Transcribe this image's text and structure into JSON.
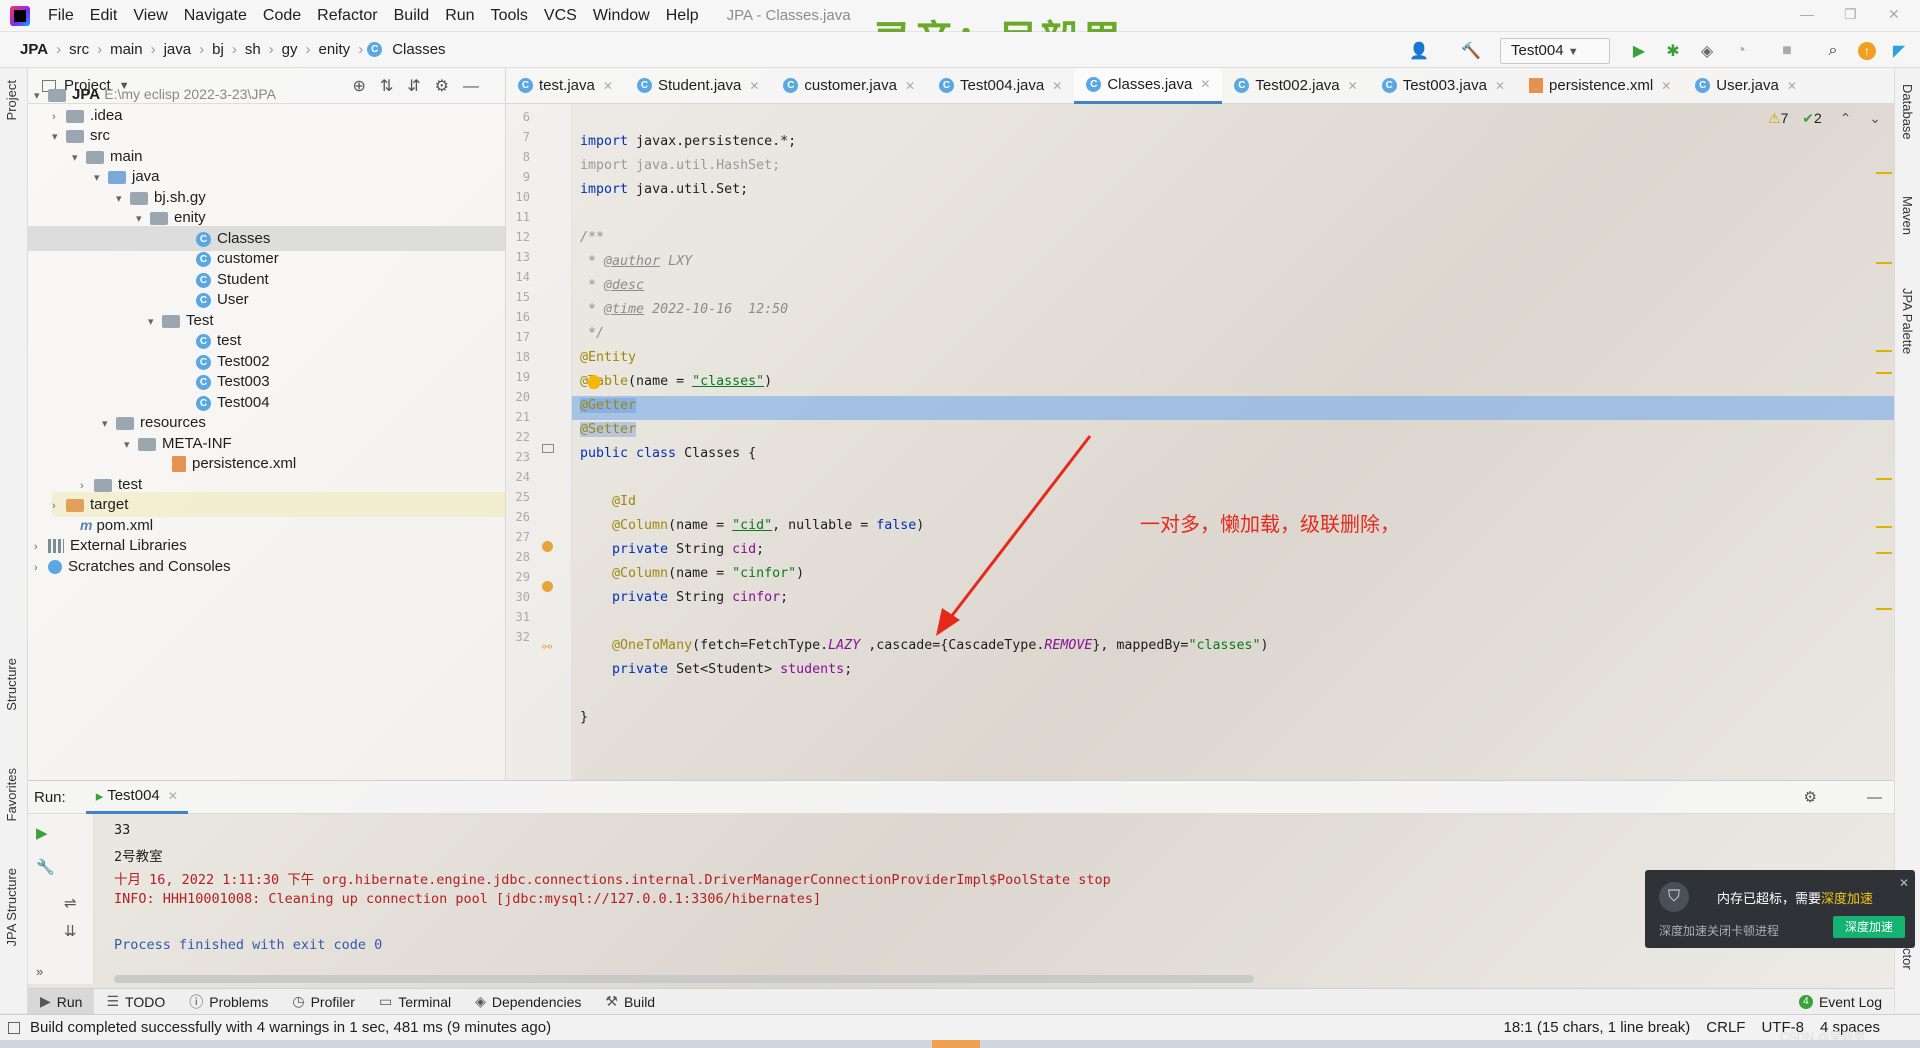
{
  "menubar": {
    "items": [
      "File",
      "Edit",
      "View",
      "Navigate",
      "Code",
      "Refactor",
      "Build",
      "Run",
      "Tools",
      "VCS",
      "Window",
      "Help"
    ],
    "window_title": "JPA - Classes.java",
    "overlay_text": "录音：吴毅男"
  },
  "navbar": {
    "crumbs": [
      "JPA",
      "src",
      "main",
      "java",
      "bj",
      "sh",
      "gy",
      "enity",
      "Classes"
    ],
    "run_config": "Test004"
  },
  "left_stripe": {
    "project": "Project",
    "structure": "Structure",
    "favorites": "Favorites",
    "jpa_structure": "JPA Structure"
  },
  "right_stripe": {
    "database": "Database",
    "maven": "Maven",
    "jpa_palette": "JPA Palette",
    "detector": "ctor"
  },
  "project": {
    "title": "Project",
    "tree": [
      {
        "label": "JPA",
        "path": "E:\\my eclisp 2022-3-23\\JPA"
      },
      {
        "label": ".idea"
      },
      {
        "label": "src"
      },
      {
        "label": "main"
      },
      {
        "label": "java"
      },
      {
        "label": "bj.sh.gy"
      },
      {
        "label": "enity"
      },
      {
        "label": "Classes"
      },
      {
        "label": "customer"
      },
      {
        "label": "Student"
      },
      {
        "label": "User"
      },
      {
        "label": "Test"
      },
      {
        "label": "test"
      },
      {
        "label": "Test002"
      },
      {
        "label": "Test003"
      },
      {
        "label": "Test004"
      },
      {
        "label": "resources"
      },
      {
        "label": "META-INF"
      },
      {
        "label": "persistence.xml"
      },
      {
        "label": "test"
      },
      {
        "label": "target"
      },
      {
        "label": "pom.xml"
      },
      {
        "label": "External Libraries"
      },
      {
        "label": "Scratches and Consoles"
      }
    ]
  },
  "tabs": [
    "test.java",
    "Student.java",
    "customer.java",
    "Test004.java",
    "Classes.java",
    "Test002.java",
    "Test003.java",
    "persistence.xml",
    "User.java"
  ],
  "editor": {
    "inspections": {
      "warnings": "7",
      "weak": "2"
    },
    "line_numbers": [
      "6",
      "7",
      "8",
      "9",
      "10",
      "11",
      "12",
      "13",
      "14",
      "15",
      "16",
      "17",
      "18",
      "19",
      "20",
      "21",
      "22",
      "23",
      "24",
      "25",
      "26",
      "27",
      "28",
      "29",
      "30",
      "31",
      "32"
    ],
    "code": {
      "l7a": "import",
      "l7b": " javax.persistence.*;",
      "l8": "import java.util.HashSet;",
      "l9a": "import",
      "l9b": " java.util.Set;",
      "l11": "/**",
      "l12a": " * ",
      "l12b": "@author",
      "l12c": " LXY",
      "l13a": " * ",
      "l13b": "@desc",
      "l14a": " * ",
      "l14b": "@time",
      "l14c": " 2022-10-16  12:50",
      "l15": " */",
      "l16": "@Entity",
      "l17a": "@Table",
      "l17b": "(name = ",
      "l17c": "\"classes\"",
      "l17d": ")",
      "l18": "@Getter",
      "l19": "@Setter",
      "l20a": "public class",
      "l20b": " Classes {",
      "l22": "    @Id",
      "l23a": "    @Column",
      "l23b": "(name = ",
      "l23c": "\"cid\"",
      "l23d": ", nullable = ",
      "l23e": "false",
      "l23f": ")",
      "l24a": "    private",
      "l24b": " String ",
      "l24c": "cid",
      "l24d": ";",
      "l25a": "    @Column",
      "l25b": "(name = ",
      "l25c": "\"cinfor\"",
      "l25d": ")",
      "l26a": "    private",
      "l26b": " String ",
      "l26c": "cinfor",
      "l26d": ";",
      "l28a": "    @OneToMany",
      "l28b": "(fetch=FetchType.",
      "l28c": "LAZY",
      "l28d": " ,cascade={CascadeType.",
      "l28e": "REMOVE",
      "l28f": "}, mappedBy=",
      "l28g": "\"classes\"",
      "l28h": ")",
      "l29a": "    private",
      "l29b": " Set<Student> ",
      "l29c": "students",
      "l29d": ";",
      "l31": "}"
    },
    "annotation_note": "一对多，懒加载，级联删除，"
  },
  "run": {
    "label": "Run:",
    "tab": "Test004",
    "console": [
      "33",
      "2号教室",
      "十月 16, 2022 1:11:30 下午 org.hibernate.engine.jdbc.connections.internal.DriverManagerConnectionProviderImpl$PoolState stop",
      "INFO: HHH10001008: Cleaning up connection pool [jdbc:mysql://127.0.0.1:3306/hibernates]",
      "Process finished with exit code 0"
    ]
  },
  "tooltabs": [
    "Run",
    "TODO",
    "Problems",
    "Profiler",
    "Terminal",
    "Dependencies",
    "Build",
    "Event Log"
  ],
  "status": {
    "message": "Build completed successfully with 4 warnings in 1 sec, 481 ms (9 minutes ago)",
    "position": "18:1 (15 chars, 1 line break)",
    "line_sep": "CRLF",
    "encoding": "UTF-8",
    "indent": "4 spaces"
  },
  "notification": {
    "title_a": "内存已超标，需要",
    "title_b": "深度加速",
    "subtitle": "深度加速关闭卡顿进程",
    "button": "深度加速"
  },
  "watermark": "CSDN @吴毅男"
}
